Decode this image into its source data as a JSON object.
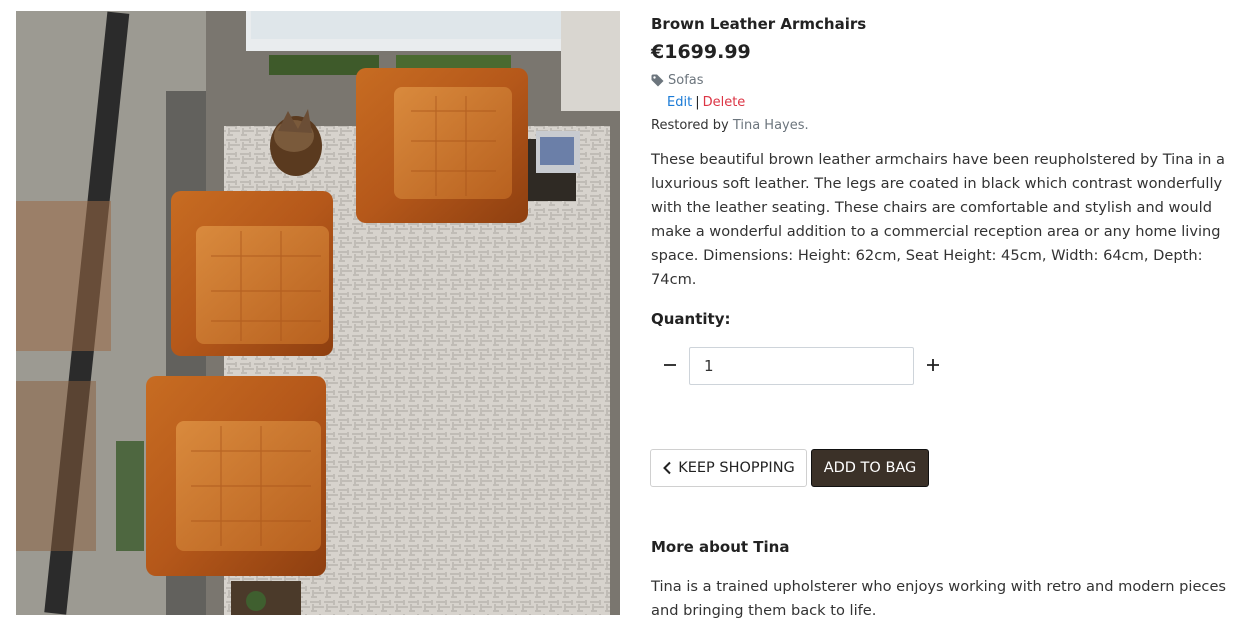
{
  "product": {
    "image_alt": "Brown Leather Armchairs",
    "title": "Brown Leather Armchairs",
    "price": "€1699.99",
    "category": "Sofas",
    "category_icon": "tag-icon",
    "edit_label": "Edit",
    "separator": "|",
    "delete_label": "Delete",
    "restored_prefix": "Restored by",
    "restorer": "Tina Hayes.",
    "description": "These beautiful brown leather armchairs have been reupholstered by Tina in a luxurious soft leather. The legs are coated in black which contrast wonderfully with the leather seating. These chairs are comfortable and stylish and would make a wonderful addition to a commercial reception area or any home living space. Dimensions: Height: 62cm, Seat Height: 45cm, Width: 64cm, Depth: 74cm."
  },
  "quantity": {
    "label": "Quantity:",
    "value": "1",
    "decrement_icon": "minus-icon",
    "increment_icon": "plus-icon"
  },
  "actions": {
    "keep_shopping": "KEEP SHOPPING",
    "keep_shopping_icon": "chevron-left-icon",
    "add_to_bag": "ADD TO BAG"
  },
  "restorer_info": {
    "title": "More about Tina",
    "text": "Tina is a trained upholsterer who enjoys working with retro and modern pieces and bringing them back to life."
  },
  "colors": {
    "add_to_bag_bg": "#3b3128",
    "edit_link": "#1a7ad6",
    "delete_link": "#dc3545",
    "muted_text": "#6c757d"
  }
}
